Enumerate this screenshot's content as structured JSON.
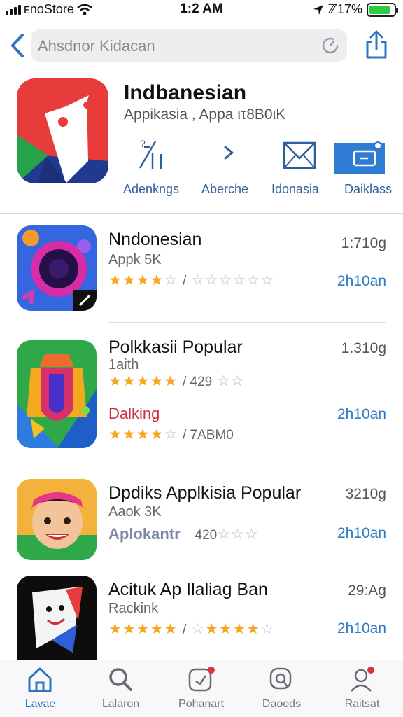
{
  "status_bar": {
    "carrier": "ᴇnoStore",
    "time": "1:2 AM",
    "battery": "ℤ17%",
    "battery_level": 0.85
  },
  "search": {
    "placeholder": "Ahsdnor Kidacan"
  },
  "header_app": {
    "title": "Indbanesian",
    "subtitle": "Appikasia , Appa ιτ8B0ιK",
    "actions": [
      {
        "label": "Adenkngs",
        "icon": "chart-lines-icon"
      },
      {
        "label": "Aberche",
        "icon": "chevron-right-icon"
      },
      {
        "label": "Idonasia",
        "icon": "mail-icon"
      },
      {
        "label": "Daiklass",
        "icon": "screen-card-icon"
      }
    ]
  },
  "apps": [
    {
      "title": "Nndonesian",
      "subtitle": "Appk 5K",
      "rating": 4,
      "rating_text": "/",
      "extra_rating": 0,
      "size": "1:710g",
      "link": "2h10an"
    },
    {
      "title": "Polkkasii Popular",
      "subtitle": "1aith",
      "rating": 5,
      "rating_text": "/ 429",
      "extra_rating": 1,
      "size": "1.310g",
      "sub_highlight": "Dalking",
      "sub_rating": 4,
      "sub_rating_text": "/ 7ABM0",
      "link_top": "",
      "link": "2h10an"
    },
    {
      "title": "Dpdiks Applkisia Popular",
      "subtitle": "Aaok 3K",
      "extra_label": "Aplokantr",
      "rating_text": "420",
      "size": "3210g",
      "link": "2h10an"
    },
    {
      "title": "Acituk Ap Ilaliag Ban",
      "subtitle": "Rackink",
      "rating": 5,
      "rating_text": "/",
      "extra_rating": 4,
      "size": "29:Ag",
      "link": "2h10an"
    }
  ],
  "tabbar": {
    "tabs": [
      {
        "label": "Lavae",
        "icon": "home-icon",
        "active": true
      },
      {
        "label": "Lalaron",
        "icon": "search-icon",
        "active": false
      },
      {
        "label": "Pohanart",
        "icon": "compass-badge-icon",
        "active": false
      },
      {
        "label": "Daoods",
        "icon": "search-bubble-icon",
        "active": false
      },
      {
        "label": "Raitsat",
        "icon": "profile-badge-icon",
        "active": false
      }
    ]
  },
  "colors": {
    "accent": "#2f74c0",
    "star": "#f5a623",
    "highlight_red": "#c8303a"
  }
}
